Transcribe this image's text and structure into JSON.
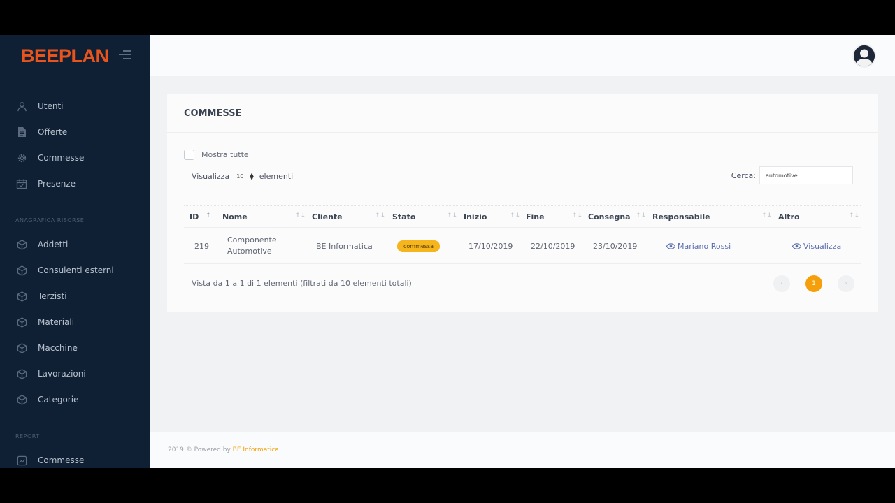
{
  "brand": {
    "name": "BEEPLAN",
    "color": "#e8541c"
  },
  "sidebar": {
    "items_top": [
      {
        "label": "Utenti",
        "icon": "user-icon"
      },
      {
        "label": "Offerte",
        "icon": "document-icon"
      },
      {
        "label": "Commesse",
        "icon": "gear-icon"
      },
      {
        "label": "Presenze",
        "icon": "calendar-icon"
      }
    ],
    "section_risorse": "Anagrafica risorse",
    "items_risorse": [
      {
        "label": "Addetti",
        "icon": "cube-icon"
      },
      {
        "label": "Consulenti esterni",
        "icon": "cube-icon"
      },
      {
        "label": "Terzisti",
        "icon": "cube-icon"
      },
      {
        "label": "Materiali",
        "icon": "cube-icon"
      },
      {
        "label": "Macchine",
        "icon": "cube-icon"
      },
      {
        "label": "Lavorazioni",
        "icon": "cube-icon"
      },
      {
        "label": "Categorie",
        "icon": "cube-icon"
      }
    ],
    "section_report": "Report",
    "items_report": [
      {
        "label": "Commesse",
        "icon": "chart-icon"
      }
    ]
  },
  "card": {
    "title": "COMMESSE",
    "show_all_label": "Mostra tutte",
    "length_prefix": "Visualizza",
    "length_value": "10",
    "length_suffix": "elementi",
    "search_label": "Cerca:",
    "search_value": "automotive",
    "columns": [
      "ID",
      "Nome",
      "Cliente",
      "Stato",
      "Inizio",
      "Fine",
      "Consegna",
      "Responsabile",
      "Altro"
    ],
    "rows": [
      {
        "id": "219",
        "nome_line1": "Componente",
        "nome_line2": "Automotive",
        "cliente": "BE Informatica",
        "stato": "commessa",
        "inizio": "17/10/2019",
        "fine": "22/10/2019",
        "consegna": "23/10/2019",
        "responsabile": "Mariano Rossi",
        "altro": "Visualizza"
      }
    ],
    "info": "Vista da 1 a 1 di 1 elementi (filtrati da 10 elementi totali)",
    "pagination": {
      "prev": "‹",
      "current": "1",
      "next": "›"
    }
  },
  "footer": {
    "text": "2019 © Powered by",
    "link": "BE Informatica"
  },
  "colors": {
    "sidebar_bg": "#0f2035",
    "accent": "#f5a00a",
    "badge": "#f5b51c",
    "link": "#5b6eb0"
  }
}
